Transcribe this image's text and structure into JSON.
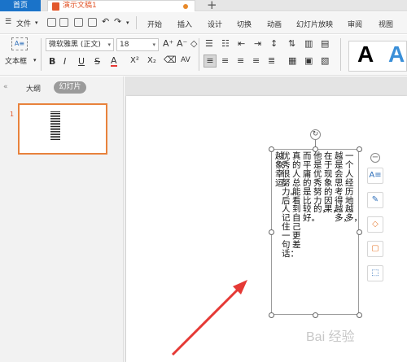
{
  "tabs": {
    "home": "首页",
    "document": "演示文稿1",
    "add": "+"
  },
  "menu": {
    "file": "文件",
    "items": [
      "开始",
      "插入",
      "设计",
      "切换",
      "动画",
      "幻灯片放映",
      "审阅",
      "视图"
    ]
  },
  "ribbon": {
    "textbox": "文本框",
    "font": "微软雅黑 (正文)",
    "size": "18",
    "format_buttons": [
      "B",
      "I",
      "U",
      "S",
      "A",
      "X²",
      "X₂"
    ]
  },
  "left_pane": {
    "collapse": "«",
    "outline_tab": "大纲",
    "slides_tab": "幻灯片",
    "slide_number": "1"
  },
  "textbox_columns": [
    "一个人经历地越多，",
    "越是会思考得越多，",
    "在于现象的因果，",
    "他是优秀努力的，",
    "而平庸的是比较好。",
    "真的人总能看到自己更差",
    "优秀很努力。后人记住一句话：",
    "的多的你会发现自己要比",
    "越象幸运。",
    "越努力，越幸运。"
  ],
  "watermark": "Bai 经验",
  "colors": {
    "accent": "#1a73c9",
    "doc_orange": "#e2572b",
    "arrow_red": "#e53935"
  }
}
